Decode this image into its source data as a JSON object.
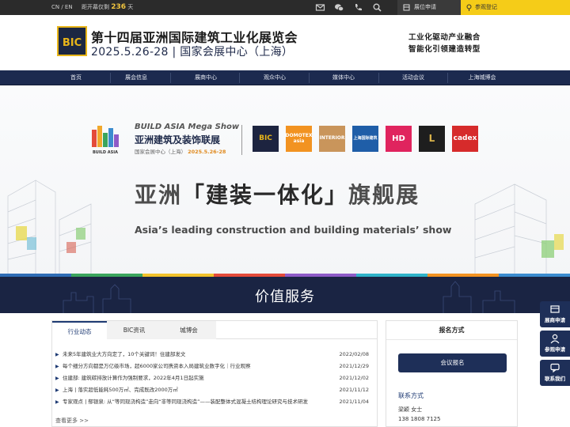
{
  "topbar": {
    "lang": "CN / EN",
    "countdown_prefix": "距开幕仅剩",
    "countdown_days": "236",
    "countdown_suffix": "天",
    "booth_label": "展位申请",
    "visitor_label": "参观登记"
  },
  "header": {
    "title": "第十四届亚洲国际建筑工业化展览会",
    "subtitle": "2025.5.26-28 | 国家会展中心（上海）",
    "slogan_line1": "工业化驱动产业融合",
    "slogan_line2": "智能化引领建造转型"
  },
  "nav": {
    "items": [
      "首页",
      "展会信息",
      "展商中心",
      "观众中心",
      "媒体中心",
      "活动会议",
      "上海城博会"
    ]
  },
  "banner": {
    "brand_en": "BUILD ASIA Mega Show",
    "brand_cn": "亚洲建筑及装饰联展",
    "venue": "国家会展中心（上海）",
    "venue_date": "2025.5.26-28",
    "headline_left": "亚洲",
    "headline_mid": "建装一体化",
    "headline_right": "旗舰展",
    "subline": "Asia’s leading construction and building materials’ show",
    "partner_logos": [
      "BIC",
      "DOMOTEX asia",
      "INTERIOR",
      "上海国际建筑",
      "HD",
      "L",
      "cadex"
    ],
    "value_text": "价值服务"
  },
  "news": {
    "tabs": [
      "行业动态",
      "BIC资讯",
      "城博会"
    ],
    "items": [
      {
        "title": "未来5年建筑业大方向定了，10个关键词！住建部发文",
        "date": "2022/02/08"
      },
      {
        "title": "每个细分方向都是万亿级市场，超6000家公司携资本入局建筑业数字化｜行业观察",
        "date": "2021/12/29"
      },
      {
        "title": "住建部: 建筑碳排放计算作为强制要求，2022年4月1日起实施",
        "date": "2021/12/02"
      },
      {
        "title": "上海 | 落实超低能耗500万㎡、完成既改2000万㎡",
        "date": "2021/11/12"
      },
      {
        "title": "专家观点 | 郁银泉: 从“等同现浇构造”走向“非等同现浇构造”——装配整体式混凝土结构理论研究与技术研发",
        "date": "2021/11/04"
      }
    ],
    "more": "查看更多 >>"
  },
  "register": {
    "title": "报名方式",
    "button": "会议报名",
    "contact_label": "联系方式",
    "contact_name": "梁颖 女士",
    "contact_phone": "138 1808 7125"
  },
  "float": {
    "items": [
      "展商申请",
      "参观申请",
      "联系我们"
    ]
  },
  "colors": {
    "nav_bg": "#1c2a4f",
    "accent_yellow": "#f5cc18",
    "brand_navy": "#1e2f58"
  }
}
